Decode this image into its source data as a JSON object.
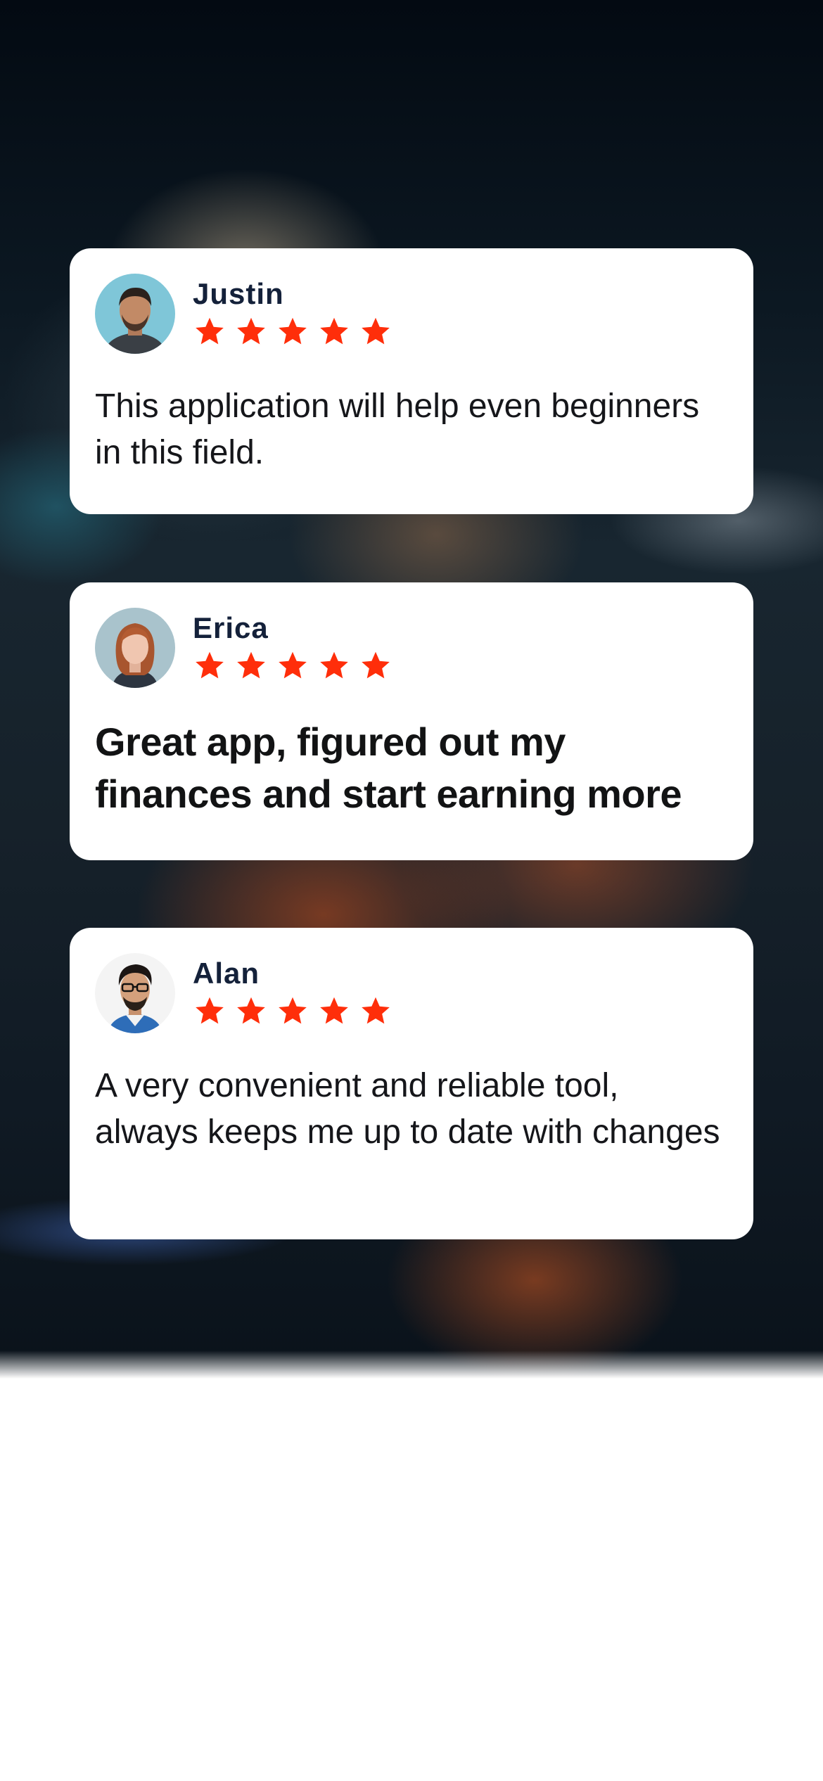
{
  "colors": {
    "star": "#ff2e0a",
    "card_background": "#ffffff",
    "name_text": "#14213a",
    "review_text": "#15161a"
  },
  "reviews": [
    {
      "name": "Justin",
      "rating": 5,
      "text": "This application will help even beginners in this field."
    },
    {
      "name": "Erica",
      "rating": 5,
      "text": "Great app, figured out my finances and start earning more"
    },
    {
      "name": "Alan",
      "rating": 5,
      "text": "A very convenient and reliable tool, always keeps me up to date with changes"
    }
  ]
}
